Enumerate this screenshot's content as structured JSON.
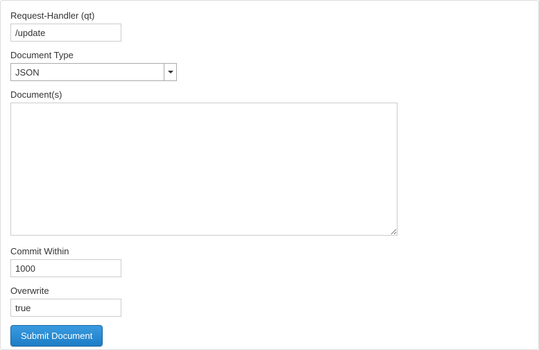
{
  "form": {
    "request_handler": {
      "label": "Request-Handler (qt)",
      "value": "/update"
    },
    "document_type": {
      "label": "Document Type",
      "selected": "JSON"
    },
    "documents": {
      "label": "Document(s)",
      "value": ""
    },
    "commit_within": {
      "label": "Commit Within",
      "value": "1000"
    },
    "overwrite": {
      "label": "Overwrite",
      "value": "true"
    },
    "submit_label": "Submit Document"
  }
}
